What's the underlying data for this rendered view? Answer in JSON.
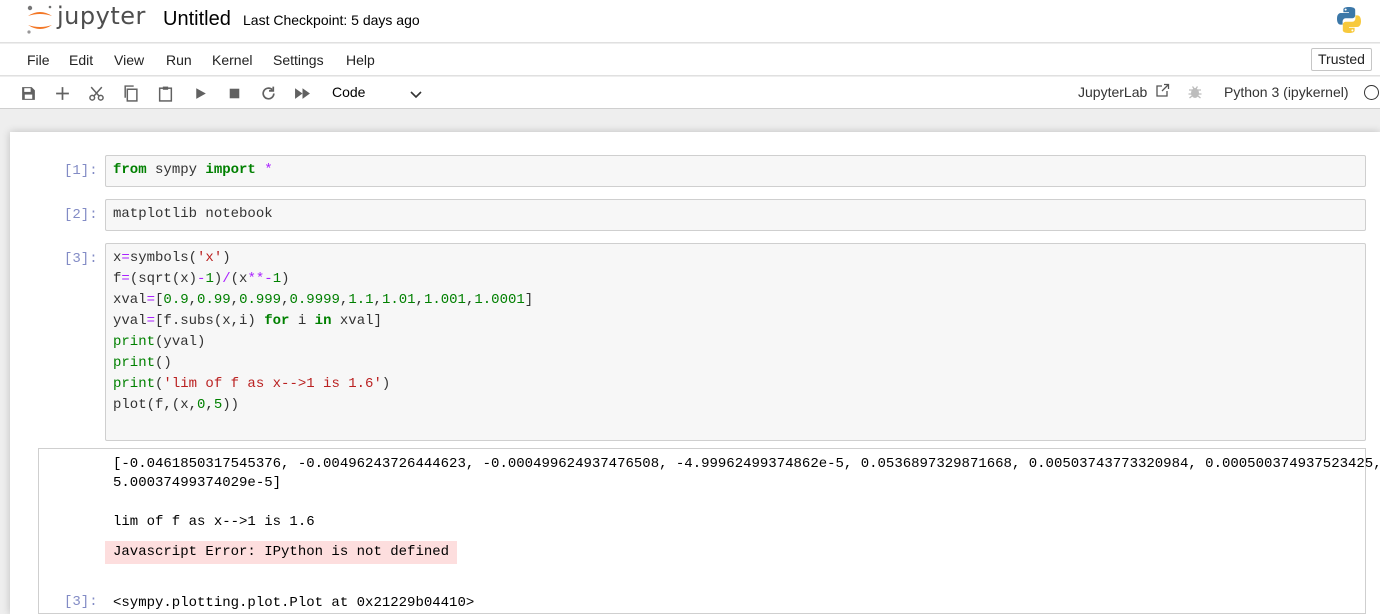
{
  "header": {
    "logo_text": "jupyter",
    "notebook_title": "Untitled",
    "checkpoint": "Last Checkpoint: 5 days ago"
  },
  "menu": {
    "items": [
      "File",
      "Edit",
      "View",
      "Run",
      "Kernel",
      "Settings",
      "Help"
    ],
    "trusted": "Trusted"
  },
  "toolbar": {
    "cell_type": "Code",
    "jupyterlab": "JupyterLab",
    "kernel": "Python 3 (ipykernel)"
  },
  "cells": [
    {
      "prompt": "[1]:",
      "lines": [
        "from sympy import *"
      ]
    },
    {
      "prompt": "[2]:",
      "lines": [
        "matplotlib notebook"
      ]
    },
    {
      "prompt": "[3]:",
      "lines": [
        "x=symbols('x')",
        "f=(sqrt(x)-1)/(x**-1)",
        "xval=[0.9,0.99,0.999,0.9999,1.1,1.01,1.001,1.0001]",
        "yval=[f.subs(x,i) for i in xval]",
        "print(yval)",
        "print()",
        "print('lim of f as x-->1 is 1.6')",
        "plot(f,(x,0,5))"
      ]
    }
  ],
  "output": {
    "line1": "[-0.0461850317545376, -0.00496243726444623, -0.000499624937476508, -4.99962499374862e-5, 0.0536897329871668, 0.00503743773320984, 0.000500374937523425,",
    "line2": "5.00037499374029e-5]",
    "line3": "lim of f as x-->1 is 1.6",
    "js_error": "Javascript Error: IPython is not defined",
    "result_prompt": "[3]:",
    "result": "<sympy.plotting.plot.Plot at 0x21229b04410>"
  },
  "colors": {
    "jupyter_orange": "#f37726",
    "prompt": "#303f9f",
    "keyword": "#008000",
    "string": "#ba2121",
    "error_bg": "#fddede"
  }
}
